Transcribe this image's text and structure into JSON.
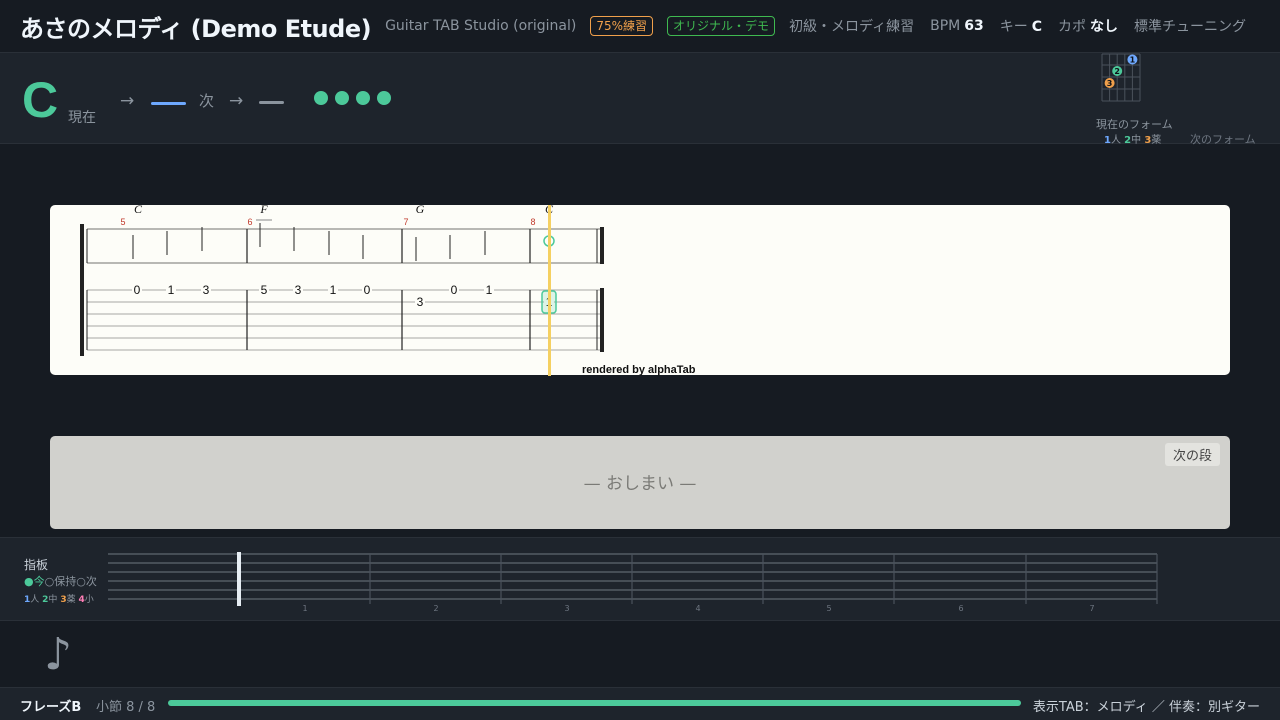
{
  "header": {
    "title": "あさのメロディ (Demo Etude)",
    "subtitle": "Guitar TAB Studio (original)",
    "badge_practice": "75%練習",
    "badge_demo": "オリジナル・デモ",
    "level": "初級・メロディ練習",
    "bpm_label": "BPM",
    "bpm_value": "63",
    "key_label": "キー",
    "key_value": "C",
    "capo_label": "カポ",
    "capo_value": "なし",
    "tuning": "標準チューニング"
  },
  "chord_panel": {
    "current_chord": "C",
    "current_label": "現在",
    "arrow": "→",
    "next_label": "次",
    "current_form_label": "現在のフォーム",
    "finger_legend": [
      {
        "num": "1",
        "name": "人"
      },
      {
        "num": "2",
        "name": "中"
      },
      {
        "num": "3",
        "name": "薬"
      }
    ],
    "next_form_label": "次のフォーム",
    "form_markers": [
      "1",
      "2",
      "3"
    ],
    "colors": {
      "accent": "#4cc99a",
      "blue": "#6ea8fe",
      "orange": "#f0a04b",
      "pink": "#ff7eb6"
    }
  },
  "score": {
    "measures": [
      {
        "number": "5",
        "chord": "C",
        "notes": [
          {
            "fret": "0",
            "string": 2
          },
          {
            "fret": "1",
            "string": 2
          },
          {
            "fret": "3",
            "string": 2
          }
        ]
      },
      {
        "number": "6",
        "chord": "F",
        "notes": [
          {
            "fret": "5",
            "string": 2
          },
          {
            "fret": "3",
            "string": 2
          },
          {
            "fret": "1",
            "string": 2
          },
          {
            "fret": "0",
            "string": 2
          }
        ]
      },
      {
        "number": "7",
        "chord": "G",
        "notes": [
          {
            "fret": "3",
            "string": 3
          },
          {
            "fret": "0",
            "string": 2
          },
          {
            "fret": "1",
            "string": 2
          }
        ]
      },
      {
        "number": "8",
        "chord": "C",
        "notes": [
          {
            "fret": "1",
            "string": 3
          }
        ]
      }
    ],
    "credit": "rendered by alphaTab"
  },
  "end_card": {
    "text": "— おしまい —",
    "next_button": "次の段"
  },
  "fretboard": {
    "title": "指板",
    "legend_now": "●今",
    "legend_hold": "○保持",
    "legend_next": "○次",
    "finger_legend": [
      {
        "num": "1",
        "name": "人"
      },
      {
        "num": "2",
        "name": "中"
      },
      {
        "num": "3",
        "name": "薬"
      },
      {
        "num": "4",
        "name": "小"
      }
    ],
    "fret_numbers": [
      "1",
      "2",
      "3",
      "4",
      "5",
      "6",
      "7"
    ]
  },
  "footer": {
    "phrase": "フレーズB",
    "measure": "小節 8 / 8",
    "progress": 1.0,
    "display_mode": "表示TAB：メロディ ／ 伴奏：別ギター"
  },
  "note_icon": "♪"
}
